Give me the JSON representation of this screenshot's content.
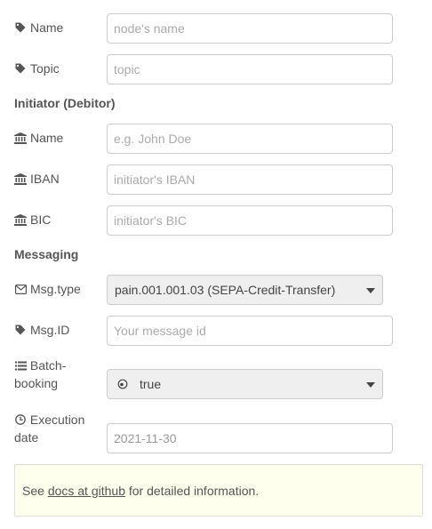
{
  "fields": {
    "name": {
      "label": "Name",
      "placeholder": "node's name"
    },
    "topic": {
      "label": "Topic",
      "placeholder": "topic"
    }
  },
  "initiator": {
    "heading": "Initiator (Debitor)",
    "name": {
      "label": "Name",
      "placeholder": "e.g. John Doe"
    },
    "iban": {
      "label": "IBAN",
      "placeholder": "initiator's IBAN"
    },
    "bic": {
      "label": "BIC",
      "placeholder": "initiator's BIC"
    }
  },
  "messaging": {
    "heading": "Messaging",
    "msg_type": {
      "label": "Msg.type",
      "selected": "pain.001.001.03 (SEPA-Credit-Transfer)"
    },
    "msg_id": {
      "label": "Msg.ID",
      "placeholder": "Your message id"
    },
    "batch": {
      "label_line1": "Batch-",
      "label_line2": "booking",
      "selected": "true"
    },
    "execution": {
      "label_line1": "Execution",
      "label_line2": "date",
      "value": "2021-11-30"
    }
  },
  "info": {
    "prefix": "See ",
    "link_text": "docs at github",
    "suffix": " for detailed information."
  },
  "icons": {
    "tag": "tag-icon",
    "bank": "bank-icon",
    "envelope": "envelope-icon",
    "list": "list-icon",
    "clock": "clock-icon",
    "radio": "radio-icon"
  }
}
